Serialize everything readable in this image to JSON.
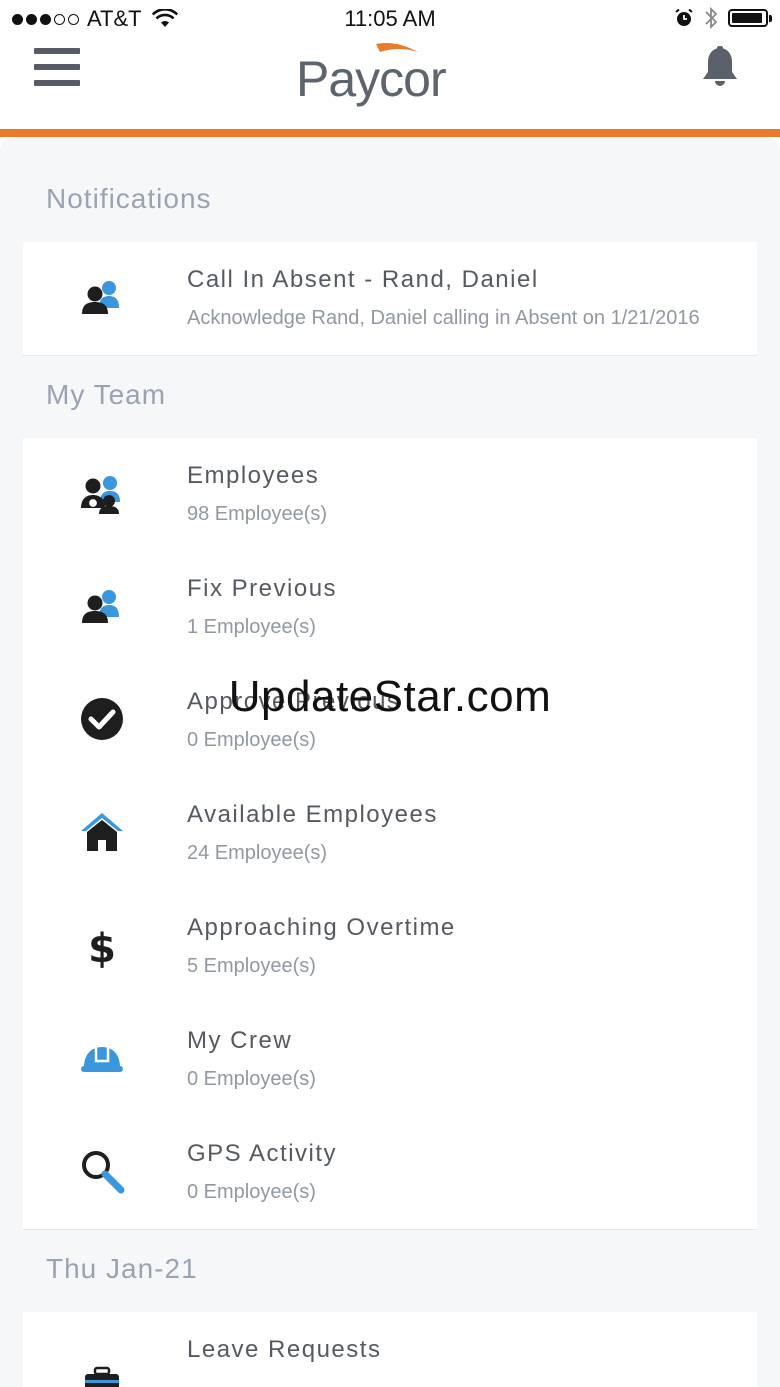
{
  "status_bar": {
    "carrier": "AT&T",
    "time": "11:05 AM",
    "signal_bars_filled": 3,
    "battery_level": 0.85
  },
  "header": {
    "logo_text": "Paycor",
    "accent_color": "#ec7a2c",
    "icon_menu": "hamburger-menu-icon",
    "icon_bell": "bell-icon"
  },
  "notifications": {
    "section_title": "Notifications",
    "items": [
      {
        "title": "Call In Absent - Rand, Daniel",
        "subtitle": "Acknowledge Rand, Daniel calling in Absent on 1/21/2016",
        "icon": "users-icon"
      }
    ]
  },
  "my_team": {
    "section_title": "My Team",
    "items": [
      {
        "title": "Employees",
        "subtitle": "98 Employee(s)",
        "icon": "employees-icon"
      },
      {
        "title": "Fix Previous",
        "subtitle": "1 Employee(s)",
        "icon": "users-icon"
      },
      {
        "title": "Approve Previous",
        "subtitle": "0 Employee(s)",
        "icon": "check-circle-icon"
      },
      {
        "title": "Available Employees",
        "subtitle": "24 Employee(s)",
        "icon": "house-icon"
      },
      {
        "title": "Approaching Overtime",
        "subtitle": "5 Employee(s)",
        "icon": "dollar-icon"
      },
      {
        "title": "My Crew",
        "subtitle": "0 Employee(s)",
        "icon": "hard-hat-icon"
      },
      {
        "title": "GPS Activity",
        "subtitle": "0 Employee(s)",
        "icon": "search-icon"
      }
    ]
  },
  "date_section": {
    "section_title": "Thu Jan-21",
    "items": [
      {
        "title": "Leave Requests",
        "icon": "briefcase-icon"
      }
    ]
  },
  "watermark": "UpdateStar.com"
}
